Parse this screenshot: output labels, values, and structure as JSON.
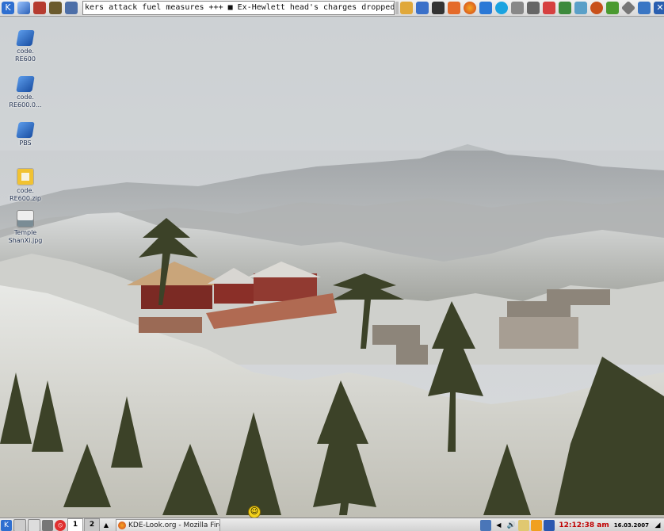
{
  "top_panel": {
    "launchers_left": [
      "kde-menu-icon",
      "cube-icon",
      "store-icon",
      "game-icon",
      "network-icon"
    ],
    "ticker_text": "kers attack fuel measures +++ ■ Ex-Hewlett head's charges dropped +++ ■ US",
    "launchers_right": [
      "resize-icon",
      "edit-icon",
      "terminal-icon",
      "home-icon",
      "firefox-icon",
      "scatter-icon",
      "skype-icon",
      "lock-icon",
      "tools-icon",
      "bookmark-icon",
      "book-icon",
      "notes-icon",
      "ball-icon",
      "leaf-icon",
      "diamond-icon",
      "compass-icon",
      "close-icon"
    ]
  },
  "desktop": {
    "icons": [
      {
        "label": "code.\nRE600",
        "icon": "folder-icon"
      },
      {
        "label": "code.\nRE600.0...",
        "icon": "folder-icon"
      },
      {
        "label": "PBS",
        "icon": "folder-icon"
      },
      {
        "label": "code.\nRE600.zip",
        "icon": "zip-icon"
      },
      {
        "label": "Temple\nShanXi.jpg",
        "icon": "image-icon"
      }
    ]
  },
  "bottom_panel": {
    "pager": [
      "1",
      "2"
    ],
    "task_label": "KDE-Look.org - Mozilla Fire",
    "clock": "12:12:38 am",
    "date": "16.03.2007"
  }
}
